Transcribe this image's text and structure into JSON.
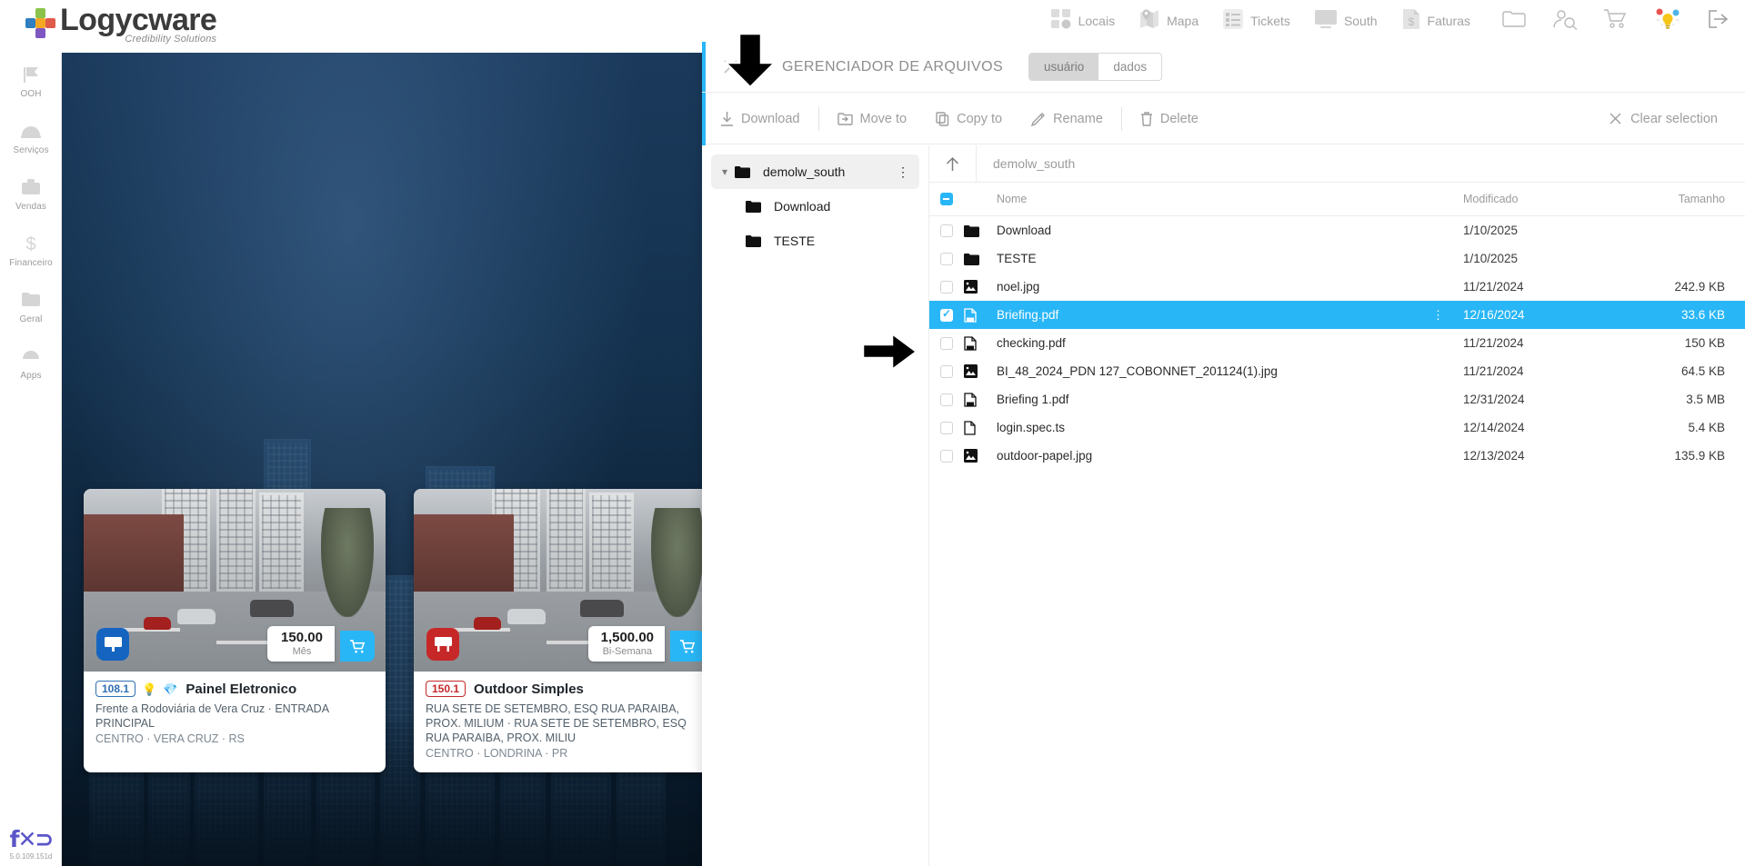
{
  "brand": {
    "name": "Logycware",
    "tagline": "Credibility Solutions"
  },
  "sidebar": {
    "items": [
      {
        "label": "OOH",
        "icon": "flag-icon"
      },
      {
        "label": "Serviços",
        "icon": "helmet-icon"
      },
      {
        "label": "Vendas",
        "icon": "briefcase-icon"
      },
      {
        "label": "Financeiro",
        "icon": "dollar-icon"
      },
      {
        "label": "Geral",
        "icon": "folder-icon"
      },
      {
        "label": "Apps",
        "icon": "apps-plus-icon"
      }
    ],
    "version": "5.0.109.151d",
    "version_logo": "fxo-logo"
  },
  "topnav": {
    "items": [
      {
        "label": "Locais",
        "icon": "grid-squares-icon"
      },
      {
        "label": "Mapa",
        "icon": "map-pin-icon"
      },
      {
        "label": "Tickets",
        "icon": "checklist-icon"
      },
      {
        "label": "South",
        "icon": "monitor-icon"
      },
      {
        "label": "Faturas",
        "icon": "invoice-dollar-icon"
      }
    ],
    "actions": [
      {
        "icon": "folder-outline-icon"
      },
      {
        "icon": "user-search-icon"
      },
      {
        "icon": "shopping-cart-icon"
      },
      {
        "icon": "lightbulb-idea-icon"
      },
      {
        "icon": "logout-icon"
      }
    ]
  },
  "cards": [
    {
      "code": "108.1",
      "name": "Painel Eletronico",
      "address": "Frente a Rodoviária de Vera Cruz · ENTRADA PRINCIPAL",
      "city": "CENTRO · VERA CRUZ · RS",
      "price": "150.00",
      "period": "Mês",
      "badge_color": "#1565c0",
      "badge_icon": "billboard-icon",
      "pill_color": "#2f6fb4",
      "mini_icons": [
        "bulb-icon",
        "diamond-icon"
      ],
      "cart_icon": "cart-add-icon"
    },
    {
      "code": "150.1",
      "name": "Outdoor Simples",
      "address": "RUA SETE DE SETEMBRO, ESQ RUA PARAIBA, PROX. MILIUM · RUA SETE DE SETEMBRO, ESQ RUA PARAIBA, PROX. MILIU",
      "city": "CENTRO · LONDRINA · PR",
      "price": "1,500.00",
      "period": "Bi-Semana",
      "badge_color": "#c62828",
      "badge_icon": "outdoor-icon",
      "pill_color": "#c62828",
      "mini_icons": [],
      "cart_icon": "cart-add-icon"
    }
  ],
  "filemanager": {
    "title": "GERENCIADOR DE ARQUIVOS",
    "close_icon": "close-icon",
    "header_icon": "folder-image-icon",
    "segments": [
      {
        "label": "usuário",
        "active": true
      },
      {
        "label": "dados",
        "active": false
      }
    ],
    "toolbar": {
      "download": "Download",
      "move_to": "Move to",
      "copy_to": "Copy to",
      "rename": "Rename",
      "delete": "Delete",
      "clear_selection": "Clear selection"
    },
    "tree": {
      "root": {
        "label": "demolw_south",
        "expanded": true
      },
      "children": [
        {
          "label": "Download"
        },
        {
          "label": "TESTE"
        }
      ]
    },
    "breadcrumb": {
      "path": "demolw_south",
      "up_icon": "arrow-up-icon"
    },
    "columns": {
      "name": "Nome",
      "modified": "Modificado",
      "size": "Tamanho"
    },
    "select_all_state": "indeterminate",
    "files": [
      {
        "name": "Download",
        "modified": "1/10/2025",
        "size": "",
        "type": "folder",
        "selected": false
      },
      {
        "name": "TESTE",
        "modified": "1/10/2025",
        "size": "",
        "type": "folder",
        "selected": false
      },
      {
        "name": "noel.jpg",
        "modified": "11/21/2024",
        "size": "242.9 KB",
        "type": "image",
        "selected": false
      },
      {
        "name": "Briefing.pdf",
        "modified": "12/16/2024",
        "size": "33.6 KB",
        "type": "pdf",
        "selected": true
      },
      {
        "name": "checking.pdf",
        "modified": "11/21/2024",
        "size": "150 KB",
        "type": "pdf",
        "selected": false
      },
      {
        "name": "BI_48_2024_PDN 127_COBONNET_201124(1).jpg",
        "modified": "11/21/2024",
        "size": "64.5 KB",
        "type": "image",
        "selected": false
      },
      {
        "name": "Briefing 1.pdf",
        "modified": "12/31/2024",
        "size": "3.5 MB",
        "type": "pdf",
        "selected": false
      },
      {
        "name": "login.spec.ts",
        "modified": "12/14/2024",
        "size": "5.4 KB",
        "type": "file",
        "selected": false
      },
      {
        "name": "outdoor-papel.jpg",
        "modified": "12/13/2024",
        "size": "135.9 KB",
        "type": "image",
        "selected": false
      }
    ]
  },
  "annotations": [
    {
      "name": "down-arrow-annotation",
      "direction": "down"
    },
    {
      "name": "right-arrow-annotation",
      "direction": "right"
    }
  ],
  "colors": {
    "accent": "#29b6f6",
    "selected_row": "#29b6f6",
    "backdrop": "#14324f"
  }
}
